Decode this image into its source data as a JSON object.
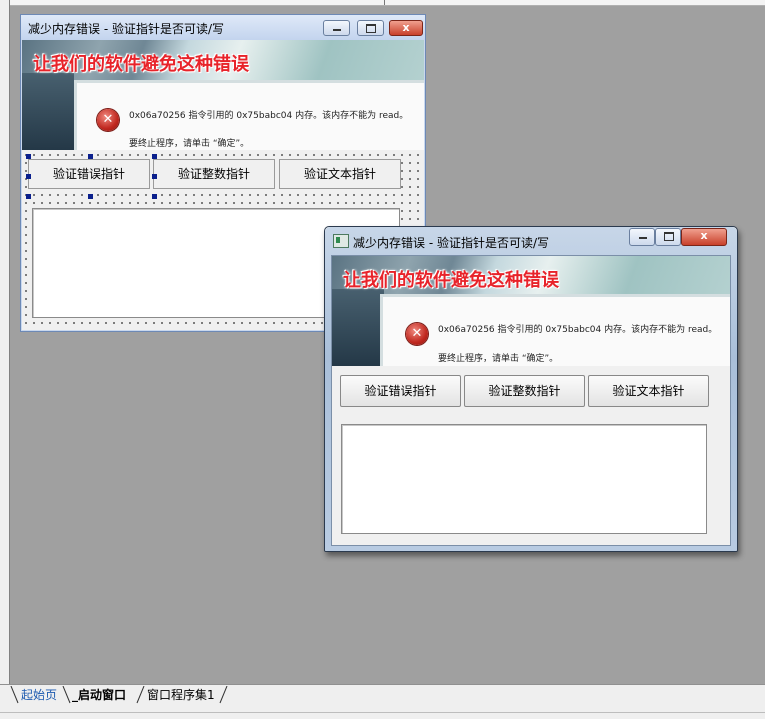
{
  "app": {
    "window_title": "减少内存错误 - 验证指针是否可读/写",
    "banner_title": "让我们的软件避免这种错误",
    "error_line1": "0x06a70256 指令引用的 0x75babc04 内存。该内存不能为 read。",
    "error_line2": "要终止程序，请单击 “确定”。",
    "buttons": {
      "verify_error_pointer": "验证错误指针",
      "verify_int_pointer": "验证整数指针",
      "verify_text_pointer": "验证文本指针"
    },
    "textbox_value": ""
  },
  "caption": {
    "close_glyph": "x"
  },
  "icons": {
    "error": "error-x-icon",
    "app": "app-icon"
  },
  "tabs": [
    {
      "label": "起始页"
    },
    {
      "label": "_启动窗口"
    },
    {
      "label": "窗口程序集1"
    }
  ],
  "colors": {
    "banner_text": "#e8232a",
    "error_icon": "#c0281f",
    "selection_handle": "#0a1f8c",
    "workspace": "#a0a0a0"
  }
}
